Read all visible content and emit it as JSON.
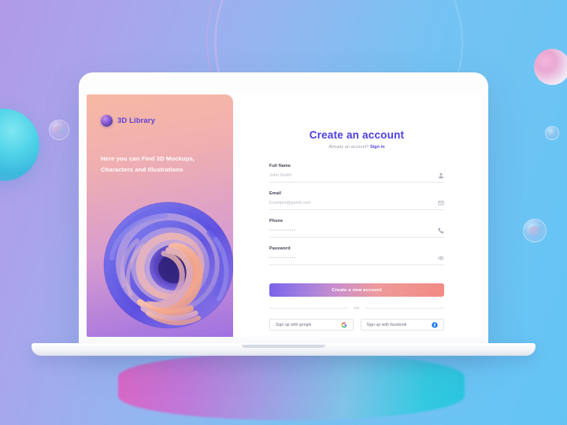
{
  "brand": {
    "name": "3D Library",
    "logo_icon": "sphere-logo-icon"
  },
  "promo": {
    "tagline_line1": "Here you can Find 3D Mockups,",
    "tagline_line2": "Characters and Illustrations",
    "artwork_name": "3d-swirl-torus-illustration"
  },
  "form": {
    "title": "Create an account",
    "subtitle_text": "Already an account?",
    "signin_link": "Sign in",
    "fields": [
      {
        "label": "Full Name",
        "value": "John Smith",
        "icon": "person-icon",
        "masked": false
      },
      {
        "label": "Email",
        "value": "Example@gamil.com",
        "icon": "envelope-icon",
        "masked": false
      },
      {
        "label": "Phone",
        "value": "••••••••••••",
        "icon": "phone-icon",
        "masked": true
      },
      {
        "label": "Password",
        "value": "••••••••••••",
        "icon": "eye-icon",
        "masked": true
      }
    ],
    "submit_label": "Create a new account",
    "divider_label": "OR",
    "social": [
      {
        "label": "Sign up with google",
        "icon": "google-icon"
      },
      {
        "label": "Sign up with facebook",
        "icon": "facebook-icon"
      }
    ]
  },
  "colors": {
    "accent_purple": "#4d3ee0",
    "cta_gradient_start": "#7a62e8",
    "cta_gradient_end": "#f28b84",
    "promo_gradient_start": "#f6b9a4",
    "promo_gradient_end": "#a071e2",
    "background_start": "#b09ae8",
    "background_end": "#63c4f4",
    "google_red": "#ea4335",
    "facebook_blue": "#1877f2"
  }
}
